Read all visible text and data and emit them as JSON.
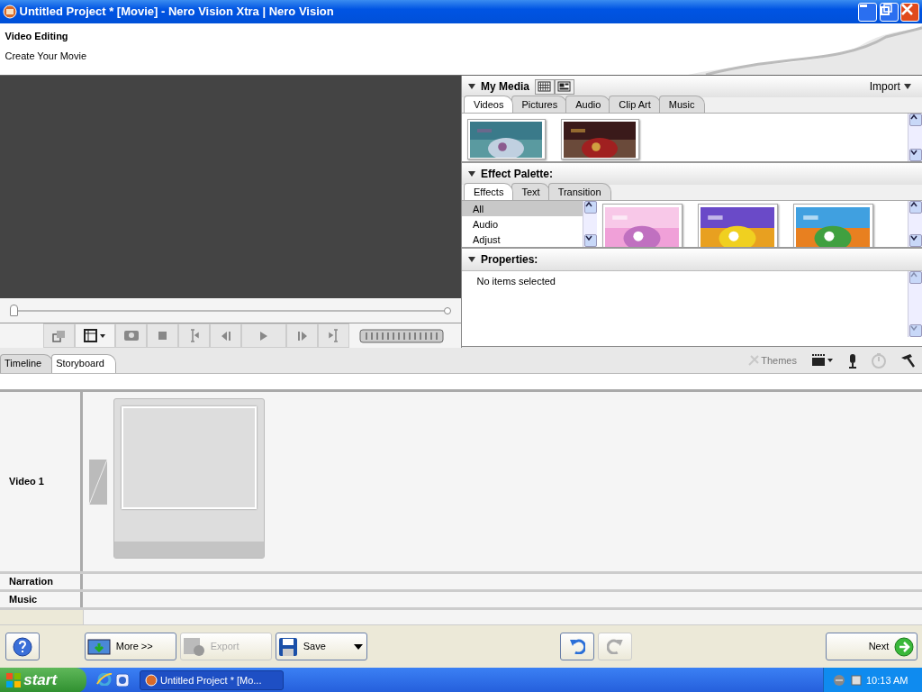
{
  "window": {
    "title": "Untitled Project * [Movie] - Nero Vision Xtra | Nero Vision"
  },
  "header": {
    "title": "Video Editing",
    "subtitle": "Create Your Movie"
  },
  "preview": {
    "position": {
      "level": 0
    },
    "controls": [
      {
        "kind": "resize",
        "disabled": true
      },
      {
        "kind": "aspect",
        "disabled": false
      },
      {
        "kind": "snapshot",
        "disabled": true
      },
      {
        "kind": "stop",
        "disabled": true
      },
      {
        "kind": "mark-in",
        "disabled": true
      },
      {
        "kind": "prev",
        "disabled": true
      },
      {
        "kind": "play",
        "disabled": true
      },
      {
        "kind": "next",
        "disabled": true
      },
      {
        "kind": "mark-out",
        "disabled": true
      }
    ]
  },
  "my_media": {
    "title": "My Media",
    "import": "Import",
    "view_buttons": [
      {
        "kind": "grid"
      },
      {
        "kind": "detail"
      }
    ],
    "tabs": [
      {
        "label": "Videos",
        "selected": true
      },
      {
        "label": "Pictures",
        "selected": false
      },
      {
        "label": "Audio",
        "selected": false
      },
      {
        "label": "Clip Art",
        "selected": false
      },
      {
        "label": "Music",
        "selected": false
      }
    ]
  },
  "effect_palette": {
    "title": "Effect Palette:",
    "tabs": [
      {
        "label": "Effects",
        "selected": true
      },
      {
        "label": "Text",
        "selected": false
      },
      {
        "label": "Transition",
        "selected": false
      }
    ],
    "categories": [
      {
        "label": "All",
        "selected": true
      },
      {
        "label": "Audio",
        "selected": false
      },
      {
        "label": "Adjust",
        "selected": false
      }
    ]
  },
  "properties": {
    "title": "Properties:",
    "message": "No items selected"
  },
  "view_tabs": [
    {
      "label": "Timeline",
      "selected": false
    },
    {
      "label": "Storyboard",
      "selected": true
    }
  ],
  "tools": [
    {
      "kind": "themes",
      "label": "Themes",
      "disabled": true
    },
    {
      "kind": "clapper",
      "disabled": false
    },
    {
      "kind": "mic",
      "disabled": false
    },
    {
      "kind": "timer",
      "disabled": true
    },
    {
      "kind": "hammer",
      "disabled": false
    }
  ],
  "tracks": [
    {
      "kind": "video",
      "label": "Video 1"
    },
    {
      "kind": "narration",
      "label": "Narration"
    },
    {
      "kind": "music",
      "label": "Music"
    }
  ],
  "bottom_buttons": [
    {
      "kind": "help",
      "disabled": false
    },
    {
      "kind": "more",
      "label": "More >>",
      "disabled": false
    },
    {
      "kind": "export",
      "label": "Export",
      "disabled": true
    },
    {
      "kind": "save",
      "label": "Save",
      "disabled": false
    },
    {
      "kind": "undo",
      "disabled": false
    },
    {
      "kind": "redo",
      "disabled": true
    },
    {
      "kind": "next",
      "label": "Next",
      "disabled": false
    }
  ],
  "taskbar": {
    "start": "start",
    "task": "Untitled Project * [Mo...",
    "clock": "10:13 AM"
  }
}
